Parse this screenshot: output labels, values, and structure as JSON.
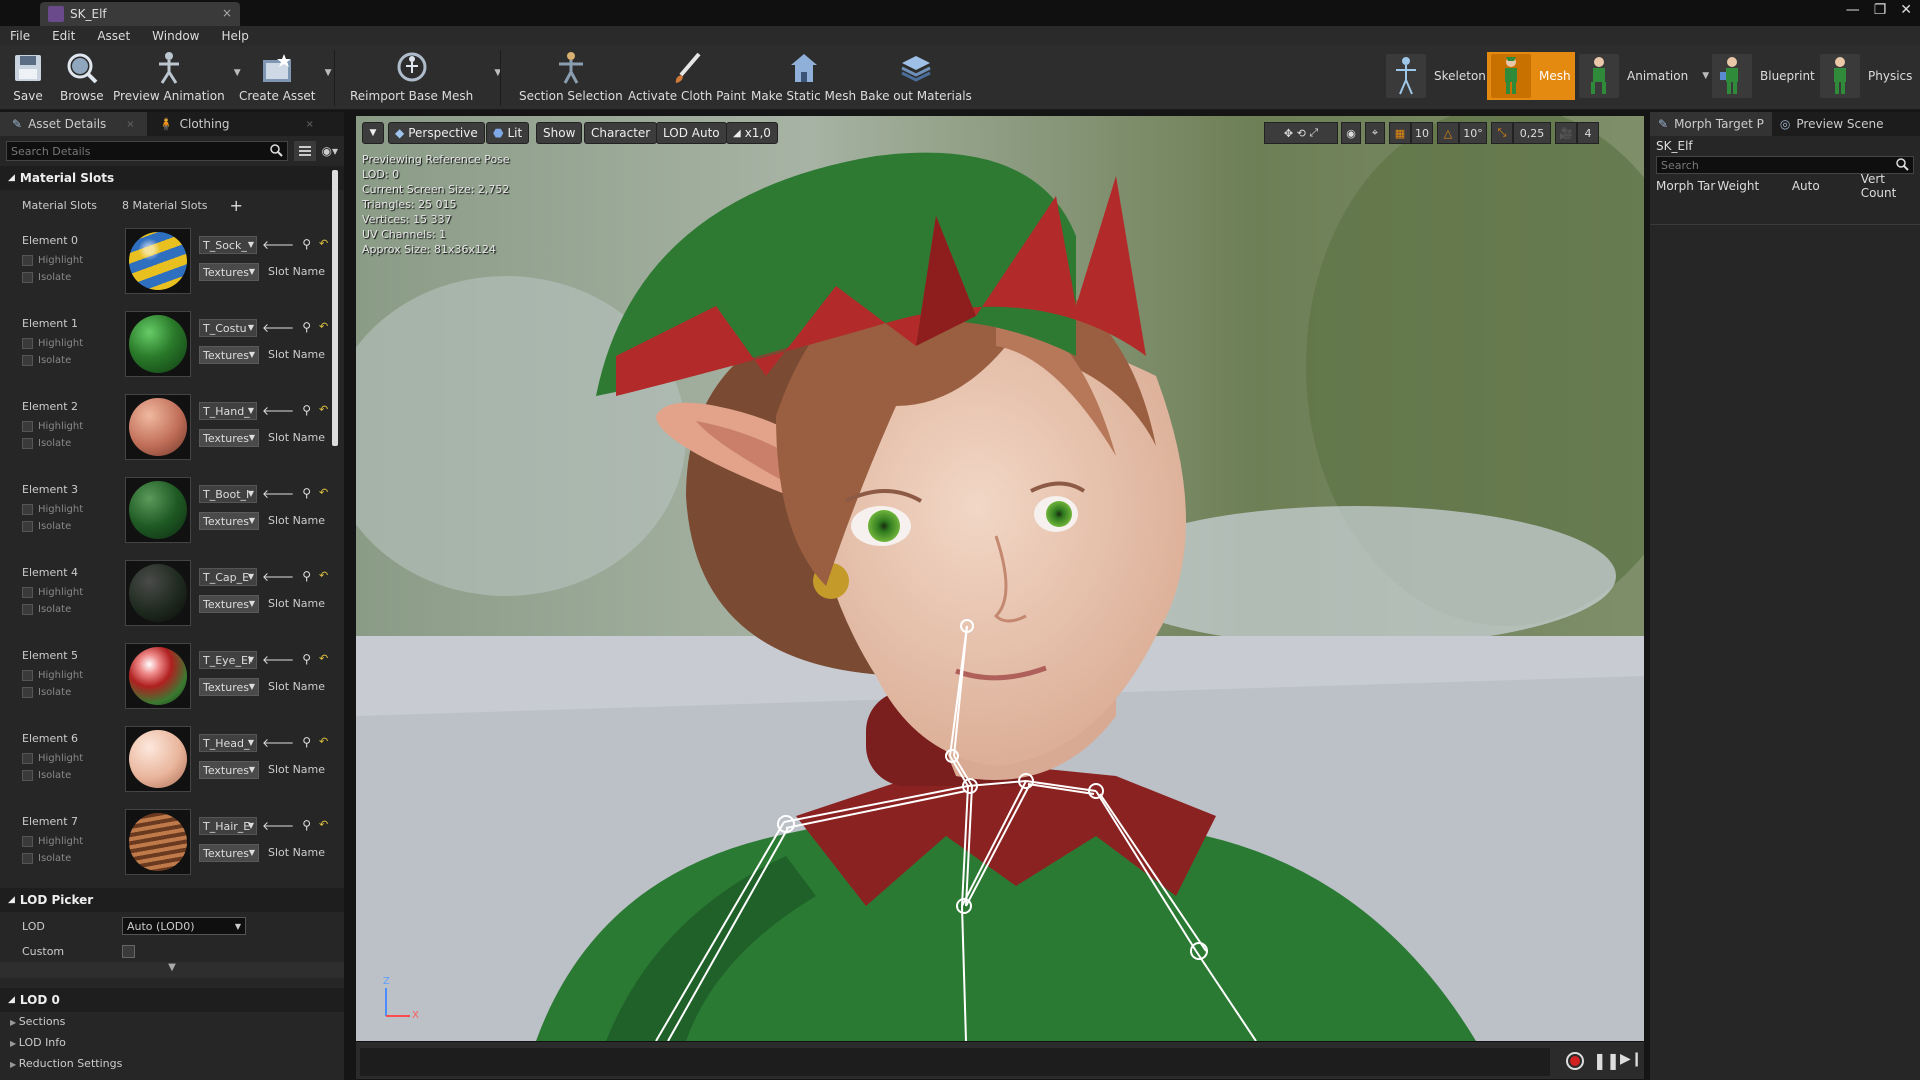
{
  "window": {
    "tab_title": "SK_Elf",
    "close_glyph": "×",
    "win_controls": [
      "—",
      "❐",
      "✕"
    ]
  },
  "menu": [
    "File",
    "Edit",
    "Asset",
    "Window",
    "Help"
  ],
  "toolbar": {
    "buttons": [
      {
        "label": "Save",
        "icon": "save-icon"
      },
      {
        "label": "Browse",
        "icon": "browse-icon"
      },
      {
        "label": "Preview Animation",
        "icon": "preview-animation-icon",
        "dropdown": true
      },
      {
        "label": "Create Asset",
        "icon": "create-asset-icon",
        "dropdown": true
      },
      {
        "label": "Reimport Base Mesh",
        "icon": "reimport-icon",
        "dropdown": true
      },
      {
        "label": "Section Selection",
        "icon": "section-selection-icon"
      },
      {
        "label": "Activate Cloth Paint",
        "icon": "cloth-paint-icon"
      },
      {
        "label": "Make Static Mesh",
        "icon": "static-mesh-icon"
      },
      {
        "label": "Bake out Materials",
        "icon": "bake-materials-icon"
      }
    ],
    "modes": [
      {
        "label": "Skeleton",
        "active": false
      },
      {
        "label": "Mesh",
        "active": true
      },
      {
        "label": "Animation",
        "active": false,
        "dropdown": true
      },
      {
        "label": "Blueprint",
        "active": false
      },
      {
        "label": "Physics",
        "active": false
      }
    ],
    "dropdown_glyph": "▼"
  },
  "left_panel": {
    "tabs": [
      {
        "label": "Asset Details",
        "active": true
      },
      {
        "label": "Clothing",
        "active": false
      }
    ],
    "tab_close": "×",
    "search_placeholder": "Search Details",
    "material_slots_header": "Material Slots",
    "material_slots_label": "Material Slots",
    "material_slots_count": "8 Material Slots",
    "add_glyph": "+",
    "highlight_label": "Highlight",
    "isolate_label": "Isolate",
    "textures_label": "Textures",
    "slot_name_label": "Slot Name",
    "elements": [
      {
        "name": "Element 0",
        "texture": "T_Sock_",
        "ball": "socks"
      },
      {
        "name": "Element 1",
        "texture": "T_Costu",
        "ball": "costume"
      },
      {
        "name": "Element 2",
        "texture": "T_Hand_",
        "ball": "hands"
      },
      {
        "name": "Element 3",
        "texture": "T_Boot_I",
        "ball": "boots"
      },
      {
        "name": "Element 4",
        "texture": "T_Cap_E",
        "ball": "cap"
      },
      {
        "name": "Element 5",
        "texture": "T_Eye_El",
        "ball": "eye"
      },
      {
        "name": "Element 6",
        "texture": "T_Head_",
        "ball": "head"
      },
      {
        "name": "Element 7",
        "texture": "T_Hair_E",
        "ball": "hair"
      }
    ],
    "lod_picker_header": "LOD Picker",
    "lod_label": "LOD",
    "lod_value": "Auto (LOD0)",
    "custom_label": "Custom",
    "lod0_header": "LOD 0",
    "lod0_items": [
      "Sections",
      "LOD Info",
      "Reduction Settings"
    ]
  },
  "viewport": {
    "options_glyph": "▼",
    "buttons": [
      "Perspective",
      "Lit",
      "Show",
      "Character",
      "LOD Auto",
      "x1,0"
    ],
    "right_values": [
      "10",
      "10°",
      "0,25",
      "4"
    ],
    "stats": [
      "Previewing Reference Pose",
      "LOD: 0",
      "Current Screen Size: 2,752",
      "Triangles: 25 015",
      "Vertices: 15 337",
      "UV Channels: 1",
      "Approx Size: 81x36x124"
    ],
    "axis": {
      "z": "Z",
      "x": "X"
    }
  },
  "right_panel": {
    "tabs": [
      {
        "label": "Morph Target P",
        "active": true
      },
      {
        "label": "Preview Scene",
        "active": false
      }
    ],
    "asset_name": "SK_Elf",
    "search_placeholder": "Search",
    "columns": [
      "Morph Tar",
      "Weight",
      "Auto",
      "Vert Count"
    ]
  },
  "colors": {
    "accent": "#e58a10",
    "panel": "#262626",
    "toolbar": "#2d2d2d"
  }
}
